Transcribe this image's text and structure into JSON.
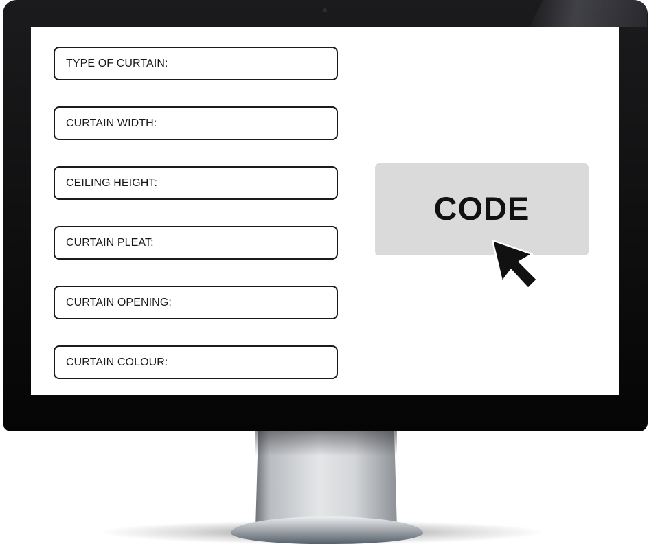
{
  "form": {
    "fields": [
      {
        "label": "TYPE OF CURTAIN:"
      },
      {
        "label": "CURTAIN WIDTH:"
      },
      {
        "label": "CEILING HEIGHT:"
      },
      {
        "label": "CURTAIN PLEAT:"
      },
      {
        "label": "CURTAIN OPENING:"
      },
      {
        "label": "CURTAIN COLOUR:"
      }
    ]
  },
  "code_button": {
    "label": "CODE"
  },
  "icons": {
    "pointer": "mouse-pointer-icon"
  }
}
